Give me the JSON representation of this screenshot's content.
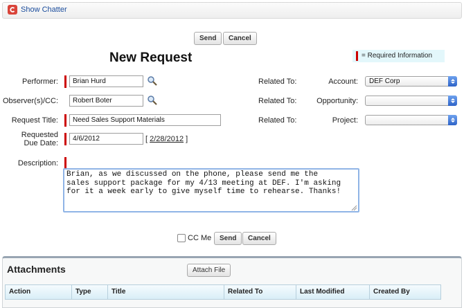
{
  "chatter": {
    "link_label": "Show Chatter"
  },
  "buttons": {
    "send": "Send",
    "cancel": "Cancel"
  },
  "page": {
    "title": "New Request",
    "required_legend": "= Required Information"
  },
  "form": {
    "performer": {
      "label": "Performer:",
      "value": "Brian Hurd"
    },
    "observers": {
      "label": "Observer(s)/CC:",
      "value": "Robert Boter"
    },
    "request_title": {
      "label": "Request Title:",
      "value": "Need Sales Support Materials"
    },
    "due_date": {
      "label_line1": "Requested",
      "label_line2": "Due Date:",
      "value": "4/6/2012",
      "today_bracket_open": "[",
      "today_link": "2/28/2012",
      "today_bracket_close": "]"
    },
    "description": {
      "label": "Description:",
      "value": "Brian, as we discussed on the phone, please send me the\nsales support package for my 4/13 meeting at DEF. I'm asking\nfor it a week early to give myself time to rehearse. Thanks!"
    }
  },
  "related": {
    "label": "Related To:",
    "account": {
      "label": "Account:",
      "value": "DEF Corp"
    },
    "opportunity": {
      "label": "Opportunity:",
      "value": ""
    },
    "project": {
      "label": "Project:",
      "value": ""
    }
  },
  "footer": {
    "cc_me_label": "CC Me"
  },
  "attachments": {
    "title": "Attachments",
    "attach_button": "Attach File",
    "columns": [
      "Action",
      "Type",
      "Title",
      "Related To",
      "Last Modified",
      "Created By"
    ]
  },
  "colors": {
    "required": "#cc0000",
    "link": "#1a4c9c",
    "legend_bg": "#e3f7fb"
  },
  "icons": {
    "chatter": "chatter-icon",
    "lookup": "magnifier-icon",
    "dropdown": "dropdown-arrow-icon"
  }
}
